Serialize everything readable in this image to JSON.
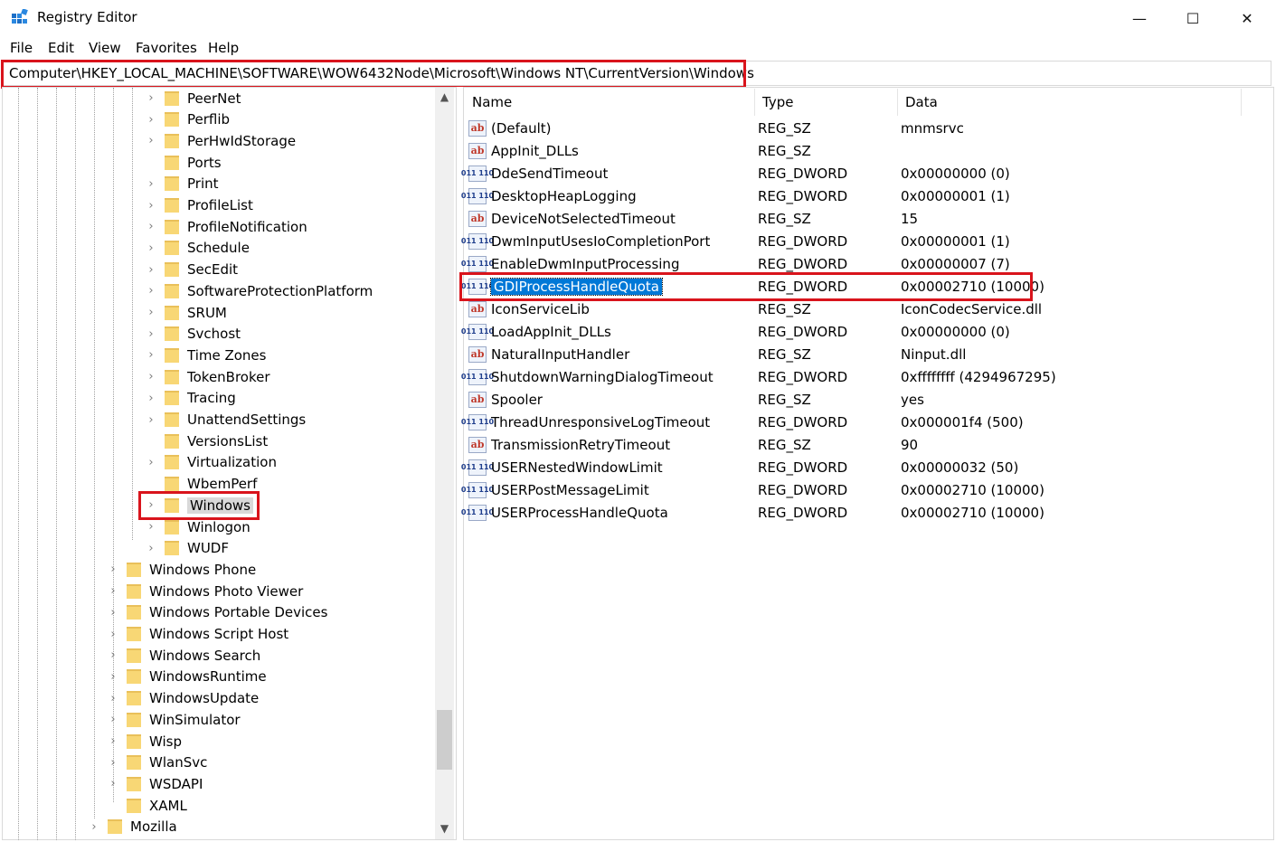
{
  "window": {
    "title": "Registry Editor",
    "minimize": "—",
    "maximize": "☐",
    "close": "✕"
  },
  "menu": [
    {
      "label": "File"
    },
    {
      "label": "Edit"
    },
    {
      "label": "View"
    },
    {
      "label": "Favorites"
    },
    {
      "label": "Help"
    }
  ],
  "address": "Computer\\HKEY_LOCAL_MACHINE\\SOFTWARE\\WOW6432Node\\Microsoft\\Windows NT\\CurrentVersion\\Windows",
  "tree": {
    "level3": [
      {
        "label": "PeerNet",
        "chevron": "›"
      },
      {
        "label": "Perflib",
        "chevron": "›"
      },
      {
        "label": "PerHwIdStorage",
        "chevron": "›"
      },
      {
        "label": "Ports",
        "chevron": ""
      },
      {
        "label": "Print",
        "chevron": "›"
      },
      {
        "label": "ProfileList",
        "chevron": "›"
      },
      {
        "label": "ProfileNotification",
        "chevron": "›"
      },
      {
        "label": "Schedule",
        "chevron": "›"
      },
      {
        "label": "SecEdit",
        "chevron": "›"
      },
      {
        "label": "SoftwareProtectionPlatform",
        "chevron": "›"
      },
      {
        "label": "SRUM",
        "chevron": "›"
      },
      {
        "label": "Svchost",
        "chevron": "›"
      },
      {
        "label": "Time Zones",
        "chevron": "›"
      },
      {
        "label": "TokenBroker",
        "chevron": "›"
      },
      {
        "label": "Tracing",
        "chevron": "›"
      },
      {
        "label": "UnattendSettings",
        "chevron": "›"
      },
      {
        "label": "VersionsList",
        "chevron": ""
      },
      {
        "label": "Virtualization",
        "chevron": "›"
      },
      {
        "label": "WbemPerf",
        "chevron": ""
      },
      {
        "label": "Windows",
        "chevron": "›",
        "selected": true
      },
      {
        "label": "Winlogon",
        "chevron": "›"
      },
      {
        "label": "WUDF",
        "chevron": "›"
      }
    ],
    "level2": [
      {
        "label": "Windows Phone",
        "chevron": "›"
      },
      {
        "label": "Windows Photo Viewer",
        "chevron": "›"
      },
      {
        "label": "Windows Portable Devices",
        "chevron": "›"
      },
      {
        "label": "Windows Script Host",
        "chevron": "›"
      },
      {
        "label": "Windows Search",
        "chevron": "›"
      },
      {
        "label": "WindowsRuntime",
        "chevron": "›"
      },
      {
        "label": "WindowsUpdate",
        "chevron": "›"
      },
      {
        "label": "WinSimulator",
        "chevron": "›"
      },
      {
        "label": "Wisp",
        "chevron": "›"
      },
      {
        "label": "WlanSvc",
        "chevron": "›"
      },
      {
        "label": "WSDAPI",
        "chevron": "›"
      },
      {
        "label": "XAML",
        "chevron": ""
      }
    ],
    "level1": [
      {
        "label": "Mozilla",
        "chevron": "›"
      }
    ]
  },
  "columns": {
    "name": "Name",
    "type": "Type",
    "data": "Data"
  },
  "values": [
    {
      "name": "(Default)",
      "type": "REG_SZ",
      "data": "mnmsrvc",
      "icon": "sz"
    },
    {
      "name": "AppInit_DLLs",
      "type": "REG_SZ",
      "data": "",
      "icon": "sz"
    },
    {
      "name": "DdeSendTimeout",
      "type": "REG_DWORD",
      "data": "0x00000000 (0)",
      "icon": "dword"
    },
    {
      "name": "DesktopHeapLogging",
      "type": "REG_DWORD",
      "data": "0x00000001 (1)",
      "icon": "dword"
    },
    {
      "name": "DeviceNotSelectedTimeout",
      "type": "REG_SZ",
      "data": "15",
      "icon": "sz"
    },
    {
      "name": "DwmInputUsesIoCompletionPort",
      "type": "REG_DWORD",
      "data": "0x00000001 (1)",
      "icon": "dword"
    },
    {
      "name": "EnableDwmInputProcessing",
      "type": "REG_DWORD",
      "data": "0x00000007 (7)",
      "icon": "dword"
    },
    {
      "name": "GDIProcessHandleQuota",
      "type": "REG_DWORD",
      "data": "0x00002710 (10000)",
      "icon": "dword",
      "selected": true
    },
    {
      "name": "IconServiceLib",
      "type": "REG_SZ",
      "data": "IconCodecService.dll",
      "icon": "sz"
    },
    {
      "name": "LoadAppInit_DLLs",
      "type": "REG_DWORD",
      "data": "0x00000000 (0)",
      "icon": "dword"
    },
    {
      "name": "NaturalInputHandler",
      "type": "REG_SZ",
      "data": "Ninput.dll",
      "icon": "sz"
    },
    {
      "name": "ShutdownWarningDialogTimeout",
      "type": "REG_DWORD",
      "data": "0xffffffff (4294967295)",
      "icon": "dword"
    },
    {
      "name": "Spooler",
      "type": "REG_SZ",
      "data": "yes",
      "icon": "sz"
    },
    {
      "name": "ThreadUnresponsiveLogTimeout",
      "type": "REG_DWORD",
      "data": "0x000001f4 (500)",
      "icon": "dword"
    },
    {
      "name": "TransmissionRetryTimeout",
      "type": "REG_SZ",
      "data": "90",
      "icon": "sz"
    },
    {
      "name": "USERNestedWindowLimit",
      "type": "REG_DWORD",
      "data": "0x00000032 (50)",
      "icon": "dword"
    },
    {
      "name": "USERPostMessageLimit",
      "type": "REG_DWORD",
      "data": "0x00002710 (10000)",
      "icon": "dword"
    },
    {
      "name": "USERProcessHandleQuota",
      "type": "REG_DWORD",
      "data": "0x00002710 (10000)",
      "icon": "dword"
    }
  ],
  "icon_glyphs": {
    "sz": "ab",
    "dword": "011 110"
  },
  "colors": {
    "highlight_box": "#d9141c",
    "selection": "#0078d7",
    "folder": "#f8d775"
  }
}
